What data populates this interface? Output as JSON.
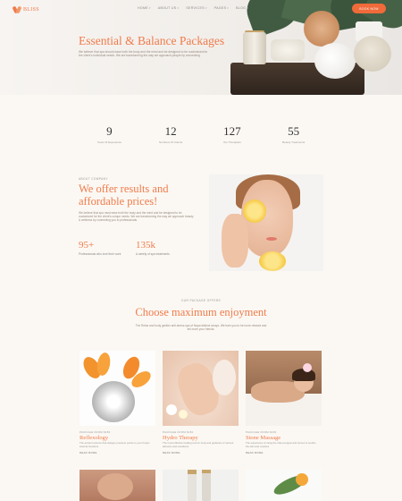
{
  "header": {
    "logo_text": "BLISS",
    "nav": [
      "HOME",
      "ABOUT US",
      "SERVICES",
      "PAGES",
      "BLOG"
    ],
    "book_button": "BOOK NOW"
  },
  "hero": {
    "title": "Essential & Balance Packages",
    "description": "We believe that spa should ease both the body and the mind and be designed to be customized for the client's individual needs. We are transforming the way we approach people by connecting"
  },
  "stats": [
    {
      "value": "9",
      "label": "Years Of Experience"
    },
    {
      "value": "12",
      "label": "Numbers Of Clients"
    },
    {
      "value": "127",
      "label": "Our Therapists"
    },
    {
      "value": "55",
      "label": "Beauty Treatments"
    }
  ],
  "offer": {
    "kicker": "ABOUT COMPANY",
    "title": "We offer results and affordable prices!",
    "description": "We believe that spa must ease both the body and the mind and be designed to be customized for the client's unique needs. We are transforming the way we approach beauty & wellness by connecting you to professionals.",
    "features": [
      {
        "value": "95+",
        "label": "Professionals who love their work"
      },
      {
        "value": "135k",
        "label": "A variety of spa treatments"
      }
    ]
  },
  "packages": {
    "kicker": "OUR PACKAGE OFFERS",
    "title": "Choose maximum enjoyment",
    "description": "The Relax and body gentler anti-stress spa of Napa distinct arrays. We train you to be more relaxed and tell more your friends.",
    "cards": [
      {
        "kicker": "PACKAGE FROM $150",
        "name": "Reflexology",
        "desc": "The ancient science that assigns pressure points to your body's internal functions",
        "more": "READ MORE"
      },
      {
        "kicker": "PACKAGE FROM $150",
        "name": "Hydro Therapy",
        "desc": "The most effective healing tool for body and guidance of various ailments and conditions",
        "more": "READ MORE"
      },
      {
        "kicker": "PACKAGE FROM $150",
        "name": "Stone Massage",
        "desc": "The experience of using the vital energies and stones to soothe the skin and muscles",
        "more": "READ MORE"
      }
    ]
  },
  "colors": {
    "accent": "#f07b4b",
    "button": "#f06a3a",
    "background": "#fbf8f3"
  }
}
